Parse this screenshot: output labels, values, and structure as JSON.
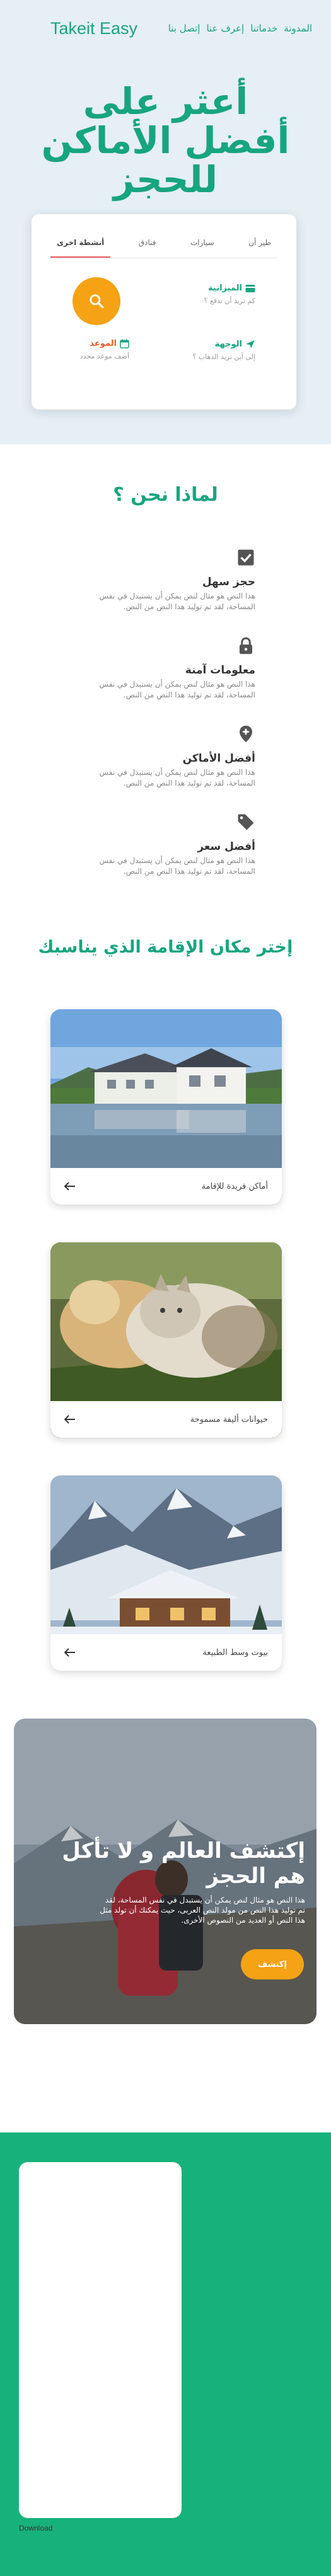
{
  "nav": {
    "brand": "Takeit Easy",
    "links": [
      "المدونة",
      "خدماتنا",
      "إعرف عنا",
      "إتصل بنا"
    ]
  },
  "hero": {
    "title": "أعثر على أفضل الأماكن للحجز"
  },
  "search": {
    "tabs": [
      "طير أن",
      "سيارات",
      "فنادق",
      "أنشطة اخرى"
    ],
    "active_tab": 3,
    "budget_label": "الميزانية",
    "budget_hint": "كم تريد أن تدفع ؟",
    "destination_label": "الوجهة",
    "destination_hint": "إلى أين تريد الذهاب ؟",
    "date_label": "الموعد",
    "date_hint": "أضف موعد محدد"
  },
  "why": {
    "title": "لماذا نحن ؟",
    "features": [
      {
        "icon": "checkbox-icon",
        "title": "حجز سهل",
        "desc": "هذا النص هو مثال لنص يمكن أن يستبدل في نفس المساحة، لقد تم توليد هذا النص من النص."
      },
      {
        "icon": "lock-icon",
        "title": "معلومات آمنة",
        "desc": "هذا النص هو مثال لنص يمكن أن يستبدل في نفس المساحة، لقد تم توليد هذا النص من النص."
      },
      {
        "icon": "location-add-icon",
        "title": "أفضل الأماكن",
        "desc": "هذا النص هو مثال لنص يمكن أن يستبدل في نفس المساحة، لقد تم توليد هذا النص من النص."
      },
      {
        "icon": "price-tag-icon",
        "title": "أفضل سعر",
        "desc": "هذا النص هو مثال لنص يمكن أن يستبدل في نفس المساحة، لقد تم توليد هذا النص من النص."
      }
    ]
  },
  "places": {
    "title": "إختر مكان الإقامة الذي يناسبك",
    "cards": [
      {
        "label": "أماكن فريدة للإقامة"
      },
      {
        "label": "حيوانات أليفة مسموحة"
      },
      {
        "label": "بيوت وسط الطبيعة"
      }
    ]
  },
  "banner": {
    "title": "إكتشف العالم و لا تأكل هم الحجز",
    "desc": "هذا النص هو مثال لنص يمكن أن يستبدل في نفس المساحة، لقد تم توليد هذا النص من مولد النص العربى، حيث يمكنك أن تولد مثل هذا النص أو العديد من النصوص الأخرى.",
    "button": "إكتشف"
  },
  "footer": {
    "download_label": "Download"
  },
  "colors": {
    "primary": "#17a57f",
    "accent": "#f5a214",
    "hero_bg": "#e6eef6",
    "footer_bg": "#17b27b"
  }
}
